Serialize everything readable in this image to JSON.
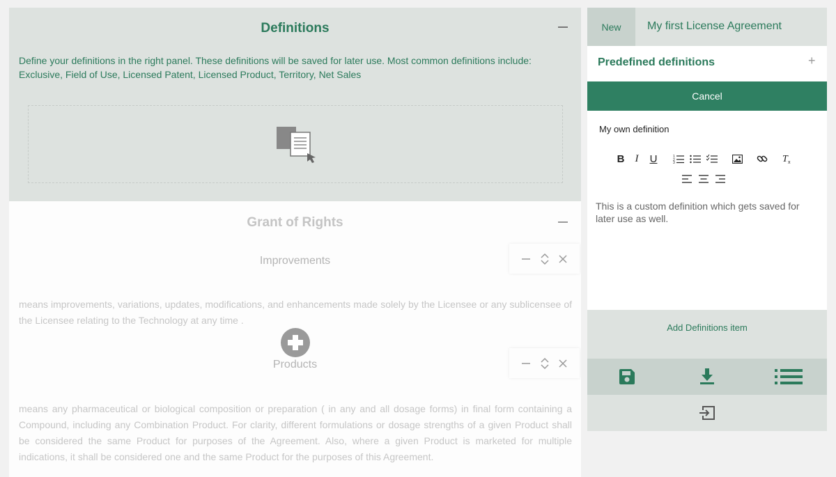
{
  "definitions": {
    "title": "Definitions",
    "description": "Define your definitions in the right panel. These definitions will be saved for later use. Most common definitions include: Exclusive, Field of Use, Licensed Patent, Licensed Product, Territory, Net Sales"
  },
  "grant_of_rights": {
    "title": "Grant of Rights",
    "items": [
      {
        "title": "Improvements",
        "text": "means improvements, variations, updates, modifications, and enhancements made solely by the Licensee or any sublicensee of the Licensee relating to the Technology at any time ."
      },
      {
        "title": "Products",
        "text": "means any pharmaceutical or biological composition or preparation ( in any and all dosage forms) in final form containing a Compound, including any Combination Product. For clarity, different formulations or dosage strengths of a given Product shall be considered the same Product for purposes of the Agreement. Also, where a given Product is marketed for multiple indications, it shall be considered one and the same Product for the purposes of this Agreement."
      }
    ]
  },
  "right_panel": {
    "new_label": "New",
    "document_name": "My first License Agreement",
    "predefined_label": "Predefined definitions",
    "predefined_toggle": "+",
    "cancel_label": "Cancel",
    "definition_name": "My own definition",
    "editor_text": "This is a custom definition which gets saved for later use as well.",
    "add_item_label": "Add Definitions item"
  },
  "icons": {
    "toolbar": [
      "bold-icon",
      "italic-icon",
      "underline-icon",
      "numbered-list-icon",
      "bullet-list-icon",
      "checklist-icon",
      "image-icon",
      "link-icon",
      "clear-format-icon",
      "align-left-icon",
      "align-center-icon",
      "align-right-icon"
    ],
    "actions": [
      "save-icon",
      "download-icon",
      "list-icon",
      "exit-icon"
    ],
    "item_controls": [
      "minimize-icon",
      "reorder-icon",
      "close-icon"
    ]
  },
  "colors": {
    "accent": "#2b7a5b",
    "button_green": "#2f8062",
    "panel_bg": "#dde2df",
    "panel_bg_dark": "#c8d2cd"
  }
}
